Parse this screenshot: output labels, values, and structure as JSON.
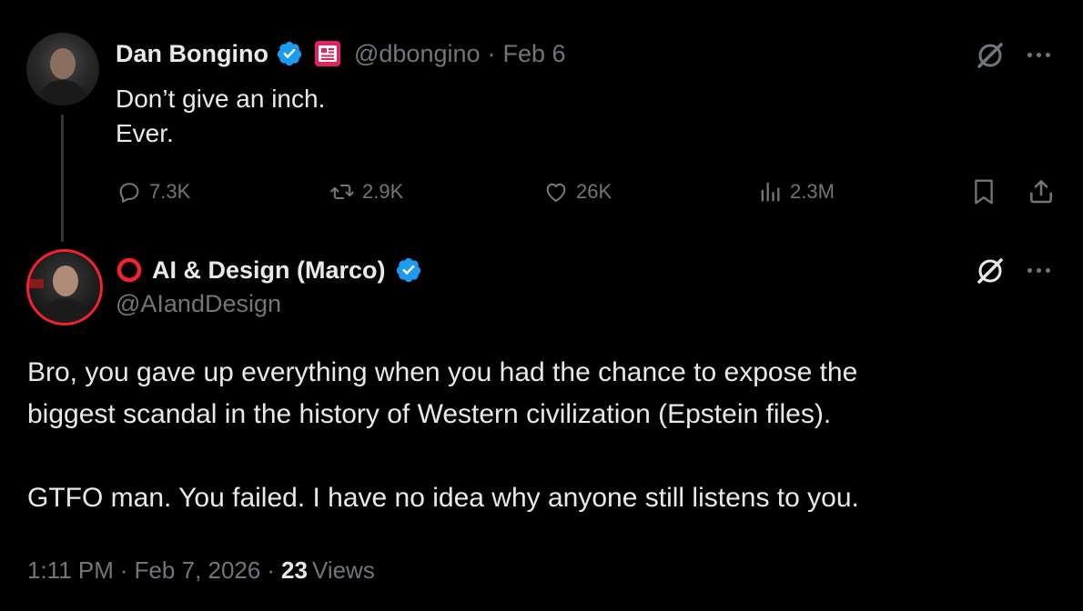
{
  "parent_tweet": {
    "author_name": "Dan Bongino",
    "handle": "@dbongino",
    "separator": "·",
    "date": "Feb 6",
    "lines": [
      "Don’t give an inch.",
      "Ever."
    ],
    "metrics": {
      "replies": "7.3K",
      "reposts": "2.9K",
      "likes": "26K",
      "views": "2.3M"
    }
  },
  "reply_tweet": {
    "author_name": "AI & Design (Marco)",
    "handle": "@AIandDesign",
    "paragraph1_lines": [
      "Bro, you gave up everything when you had the chance to expose the",
      "biggest scandal in the history of Western civilization (Epstein files)."
    ],
    "paragraph2": "GTFO man. You failed. I have no idea why anyone still listens to you.",
    "time": "1:11 PM",
    "date": "Feb 7, 2026",
    "views_count": "23",
    "views_label": "Views"
  },
  "colors": {
    "background": "#000000",
    "text": "#e7e9ea",
    "muted": "#71767b",
    "verified": "#1d9bf0",
    "affiliate_badge": "#e0245e",
    "ring": "#f4212e"
  },
  "icons": {
    "grok": "grok-icon",
    "more": "more-icon",
    "reply": "reply-icon",
    "repost": "repost-icon",
    "like": "like-icon",
    "views": "views-icon",
    "bookmark": "bookmark-icon",
    "share": "share-icon"
  }
}
